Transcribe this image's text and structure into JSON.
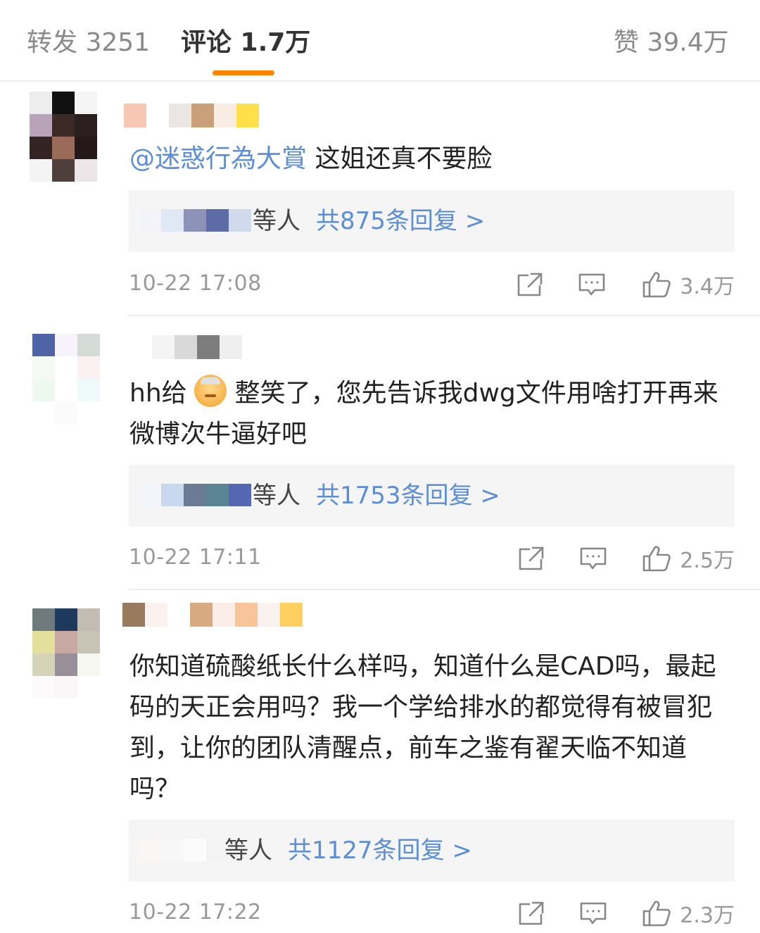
{
  "tabs": {
    "repost": "转发 3251",
    "comments": "评论 1.7万",
    "likes": "赞 39.4万"
  },
  "comments": [
    {
      "mention": "@迷惑行為大賞",
      "text": " 这姐还真不要脸",
      "reply_by": "等人",
      "reply_link": "共875条回复 >",
      "time": "10-22 17:08",
      "like_count": "3.4万"
    },
    {
      "text_before_emoji": "hh给",
      "emoji": "old-man-emoji",
      "text_after_emoji": "整笑了，您先告诉我dwg文件用啥打开再来微博次牛逼好吧",
      "reply_by": "等人",
      "reply_link": "共1753条回复 >",
      "time": "10-22 17:11",
      "like_count": "2.5万"
    },
    {
      "text": "你知道硫酸纸长什么样吗，知道什么是CAD吗，最起码的天正会用吗？我一个学给排水的都觉得有被冒犯到，让你的团队清醒点，前车之鉴有翟天临不知道吗？",
      "reply_by": "等人",
      "reply_link": "共1127条回复 >",
      "time": "10-22 17:22",
      "like_count": "2.3万"
    }
  ],
  "colors": {
    "accent": "#ff8200",
    "link": "#5b8ed6",
    "muted": "#999999",
    "reply_bg": "#f5f5f5"
  }
}
